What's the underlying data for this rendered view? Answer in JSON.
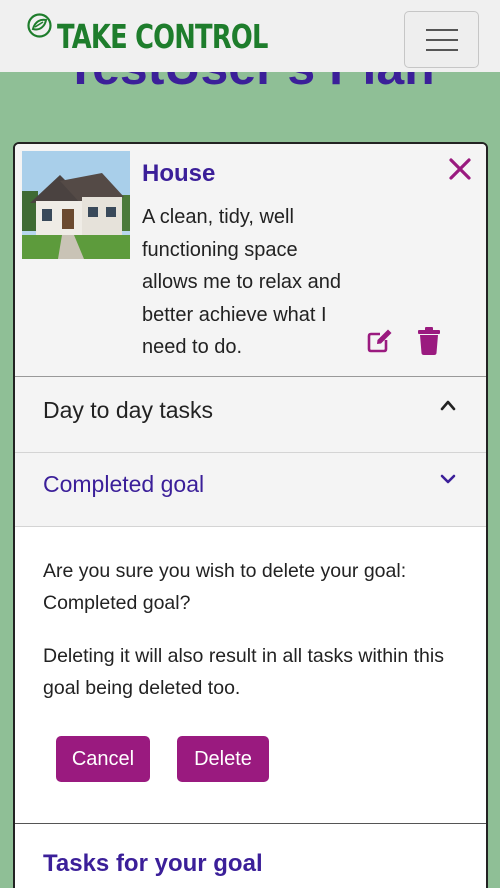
{
  "navbar": {
    "brand": "TAKE CONTROL",
    "brand_icon": "leaf-logo-icon",
    "menu_icon": "hamburger-menu-icon"
  },
  "page": {
    "heading": "TestUser's Plan"
  },
  "goal_card": {
    "title": "House",
    "image": "house-photo",
    "description": "A clean, tidy, well functioning space allows me to relax and better achieve what I need to do.",
    "icons": {
      "close": "close-icon",
      "edit": "edit-icon",
      "delete": "trash-icon"
    }
  },
  "accordion": {
    "items": [
      {
        "label": "Day to day tasks",
        "expanded": true
      },
      {
        "label": "Completed goal",
        "expanded": false
      }
    ]
  },
  "delete_confirm": {
    "question": "Are you sure you wish to delete your goal: Completed goal?",
    "warning": "Deleting it will also result in all tasks within this goal being deleted too.",
    "cancel_label": "Cancel",
    "delete_label": "Delete"
  },
  "tasks": {
    "heading": "Tasks for your goal"
  },
  "colors": {
    "background": "#8fbf96",
    "brand_green": "#1e7d2c",
    "heading_purple": "#3b1f99",
    "button_magenta": "#9a1a7f"
  }
}
